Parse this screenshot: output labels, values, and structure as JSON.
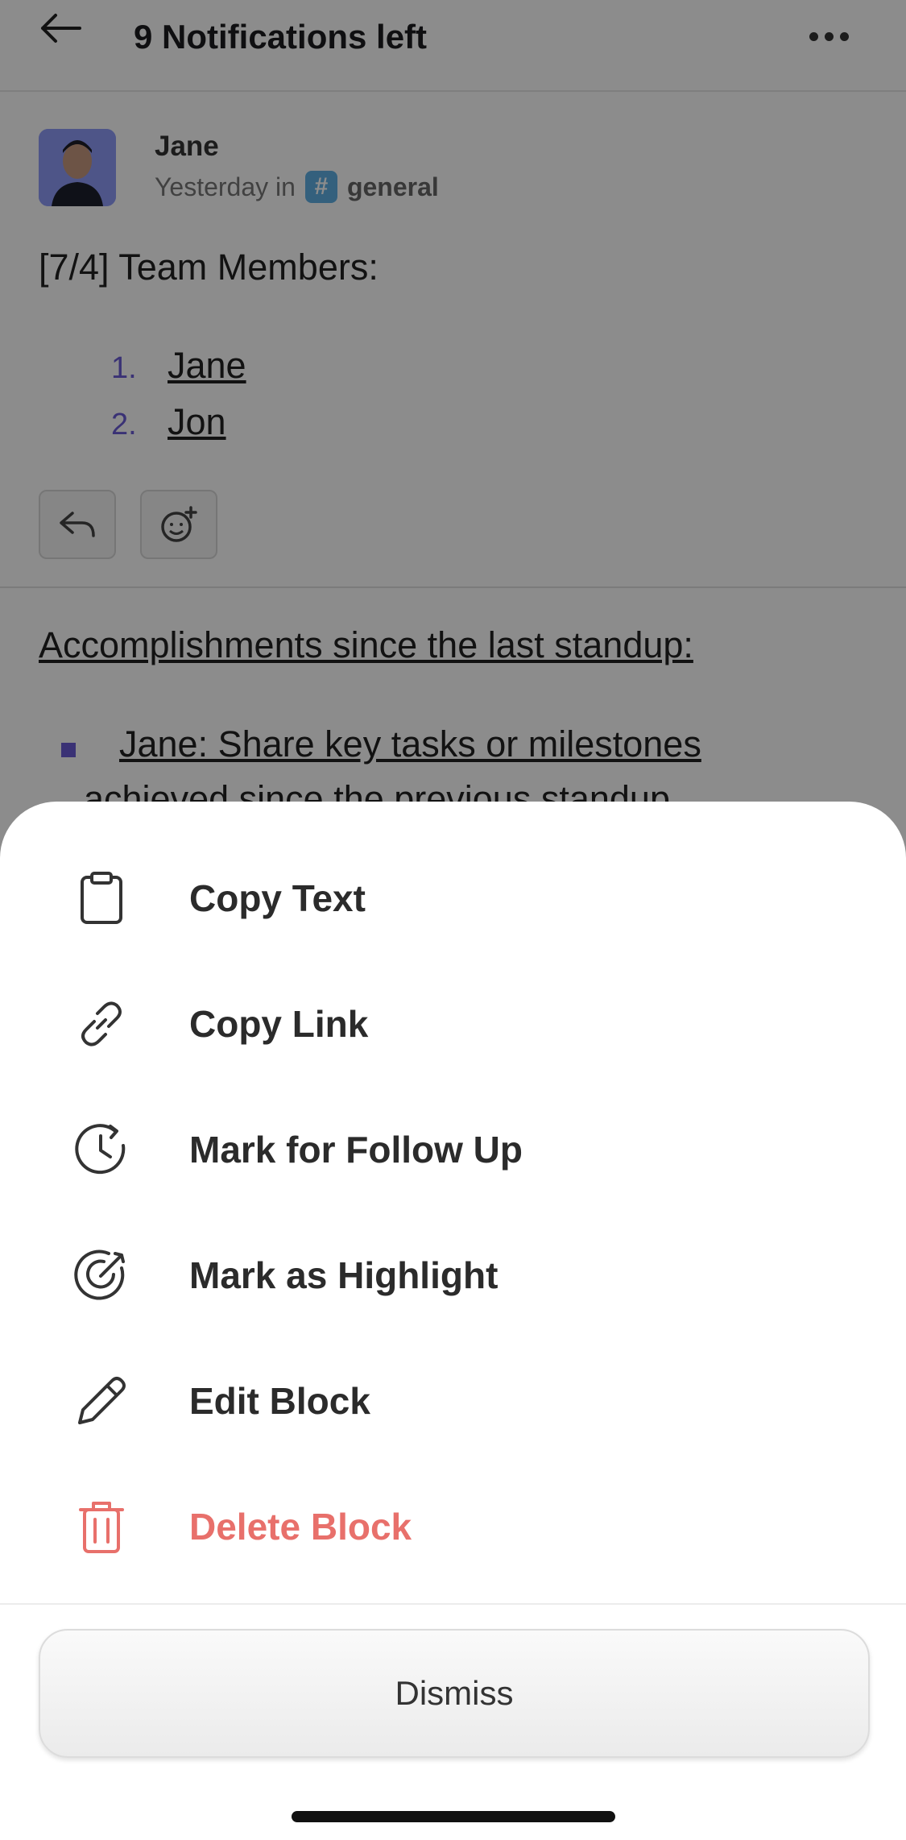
{
  "header": {
    "title": "9 Notifications left",
    "back_icon": "arrow-left-icon",
    "more_icon": "more-horizontal-icon"
  },
  "message": {
    "author": "Jane",
    "time_prefix": "Yesterday in",
    "channel_symbol": "#",
    "channel": "general",
    "title": "[7/4] Team Members:",
    "members": [
      {
        "num": "1.",
        "name": "Jane"
      },
      {
        "num": "2.",
        "name": "Jon"
      }
    ],
    "reply_icon": "reply-icon",
    "react_icon": "add-reaction-icon"
  },
  "section": {
    "title": "Accomplishments since the last standup:",
    "bullet_text": "Jane: Share key tasks or milestones",
    "bullet_cont": "achieved since the previous standup"
  },
  "sheet": {
    "items": [
      {
        "label": "Copy Text",
        "icon": "clipboard-icon"
      },
      {
        "label": "Copy Link",
        "icon": "link-icon"
      },
      {
        "label": "Mark for Follow Up",
        "icon": "clock-refresh-icon"
      },
      {
        "label": "Mark as Highlight",
        "icon": "target-icon"
      },
      {
        "label": "Edit Block",
        "icon": "pencil-icon"
      },
      {
        "label": "Delete Block",
        "icon": "trash-icon",
        "color": "#e8706b"
      }
    ],
    "dismiss_label": "Dismiss"
  },
  "colors": {
    "accent": "#6a5bd6",
    "danger": "#e8706b",
    "channel_badge": "#5fb0e3"
  }
}
